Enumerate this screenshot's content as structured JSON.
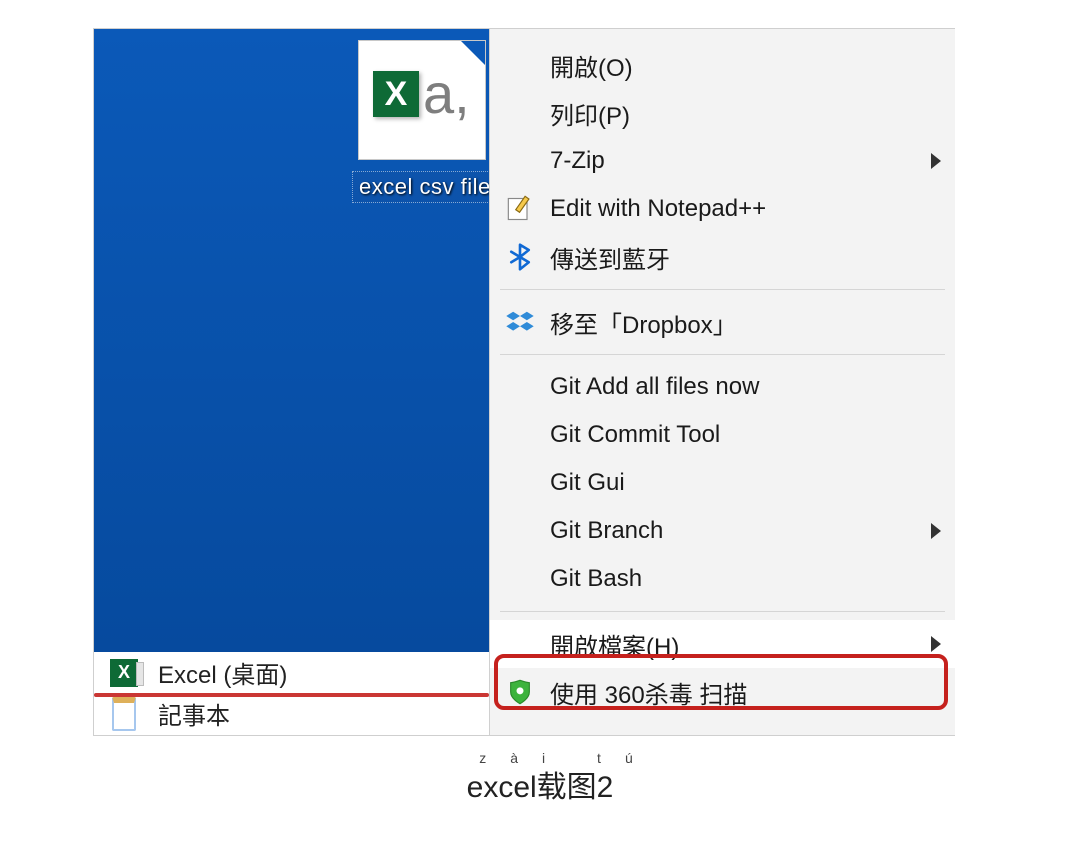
{
  "desktop": {
    "file_icon": {
      "label": "excel csv file",
      "icon_letter": "X",
      "suffix": "a,"
    }
  },
  "programs": {
    "excel_label": "Excel (桌面)",
    "notepad_label": "記事本"
  },
  "context_menu": {
    "open": "開啟(O)",
    "print": "列印(P)",
    "sevenzip": "7-Zip",
    "edit_npp": "Edit with Notepad++",
    "send_bt": "傳送到藍牙",
    "move_dropbox": "移至「Dropbox」",
    "git_add": "Git Add all files now",
    "git_commit": "Git Commit Tool",
    "git_gui": "Git Gui",
    "git_branch": "Git Branch",
    "git_bash": "Git Bash",
    "open_with": "開啟檔案(H)",
    "scan_360": "使用 360杀毒 扫描"
  },
  "caption": {
    "ruby": "zài  tú",
    "main": "excel载图2"
  },
  "colors": {
    "desktop_bg": "#064a9e",
    "highlight_red": "#c5211d",
    "excel_green": "#0e6a36"
  }
}
